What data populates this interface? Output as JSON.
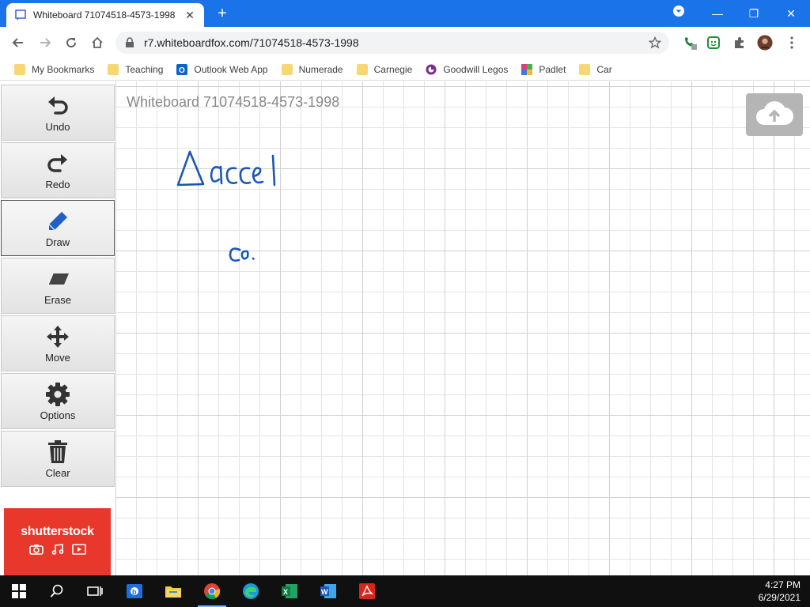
{
  "browser": {
    "tab_title": "Whiteboard 71074518-4573-1998",
    "url": "r7.whiteboardfox.com/71074518-4573-1998"
  },
  "bookmarks": [
    {
      "label": "My Bookmarks",
      "icon": "folder-icon"
    },
    {
      "label": "Teaching",
      "icon": "folder-icon"
    },
    {
      "label": "Outlook Web App",
      "icon": "outlook-icon"
    },
    {
      "label": "Numerade",
      "icon": "folder-icon"
    },
    {
      "label": "Carnegie",
      "icon": "folder-icon"
    },
    {
      "label": "Goodwill Legos",
      "icon": "goodwill-icon"
    },
    {
      "label": "Padlet",
      "icon": "padlet-icon"
    },
    {
      "label": "Car",
      "icon": "folder-icon"
    }
  ],
  "tools": [
    {
      "label": "Undo",
      "icon": "undo-icon"
    },
    {
      "label": "Redo",
      "icon": "redo-icon"
    },
    {
      "label": "Draw",
      "icon": "pencil-icon",
      "active": true
    },
    {
      "label": "Erase",
      "icon": "eraser-icon"
    },
    {
      "label": "Move",
      "icon": "move-icon"
    },
    {
      "label": "Options",
      "icon": "gear-icon"
    },
    {
      "label": "Clear",
      "icon": "trash-icon"
    }
  ],
  "whiteboard": {
    "title": "Whiteboard 71074518-4573-1998",
    "ink_color": "#1a56b8"
  },
  "ad": {
    "brand": "shutterstock"
  },
  "taskbar": {
    "time": "4:27 PM",
    "date": "6/29/2021"
  },
  "colors": {
    "browser_accent": "#1a73e8",
    "ad_red": "#e8382b"
  }
}
